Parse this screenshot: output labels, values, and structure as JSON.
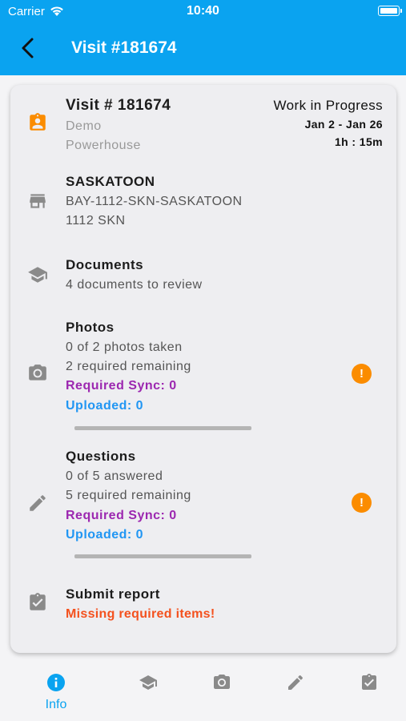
{
  "status_bar": {
    "carrier": "Carrier",
    "time": "10:40"
  },
  "nav": {
    "title": "Visit #181674"
  },
  "visit": {
    "title": "Visit # 181674",
    "client_line1": "Demo",
    "client_line2": "Powerhouse",
    "status": "Work in Progress",
    "dates": "Jan 2 - Jan 26",
    "duration": "1h : 15m"
  },
  "location": {
    "title": "SASKATOON",
    "line1": "BAY-1112-SKN-SASKATOON",
    "line2": "1112 SKN"
  },
  "documents": {
    "title": "Documents",
    "line1": "4 documents to review"
  },
  "photos": {
    "title": "Photos",
    "line1": "0 of 2 photos taken",
    "line2": "2 required remaining",
    "sync": "Required Sync: 0",
    "uploaded": "Uploaded: 0",
    "progress": 0,
    "warning": "!"
  },
  "questions": {
    "title": "Questions",
    "line1": "0 of 5 answered",
    "line2": "5 required remaining",
    "sync": "Required Sync: 0",
    "uploaded": "Uploaded: 0",
    "progress": 0,
    "warning": "!"
  },
  "submit": {
    "title": "Submit report",
    "status": "Missing required items!"
  },
  "tabs": [
    {
      "label": "Info",
      "icon": "info-icon",
      "active": true
    },
    {
      "label": "",
      "icon": "school-icon"
    },
    {
      "label": "",
      "icon": "camera-icon"
    },
    {
      "label": "",
      "icon": "pencil-icon"
    },
    {
      "label": "",
      "icon": "clipboard-check-icon"
    }
  ],
  "colors": {
    "brand": "#0aa3f0",
    "warning": "#fb8c00",
    "sync": "#9c27b0",
    "uploaded": "#2196f3",
    "error": "#f4511e"
  }
}
